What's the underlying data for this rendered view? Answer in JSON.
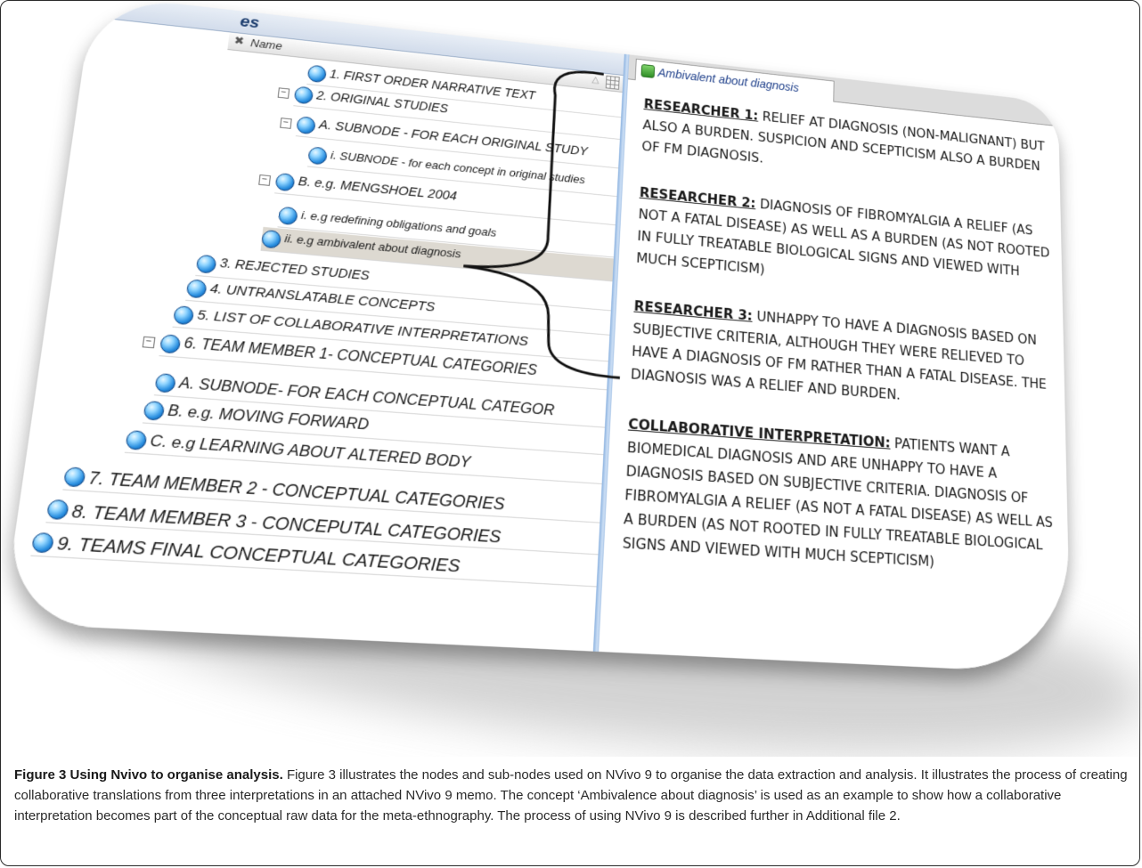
{
  "left_pane": {
    "title": "es",
    "column_header": "Name",
    "tree": [
      {
        "label": "1. FIRST ORDER NARRATIVE TEXT"
      },
      {
        "label": "2. ORIGINAL STUDIES",
        "expander": "−"
      },
      {
        "label": "A. SUBNODE - FOR EACH ORIGINAL STUDY",
        "expander": "−"
      },
      {
        "label": "i. SUBNODE - for each concept in original studies"
      },
      {
        "label": "B. e.g. MENGSHOEL 2004",
        "expander": "−"
      },
      {
        "label": "i. e.g redefining obligations and goals"
      },
      {
        "label": "ii. e.g ambivalent about diagnosis",
        "selected": true
      },
      {
        "label": "3. REJECTED STUDIES"
      },
      {
        "label": "4. UNTRANSLATABLE CONCEPTS"
      },
      {
        "label": "5. LIST OF COLLABORATIVE INTERPRETATIONS"
      },
      {
        "label": "6. TEAM MEMBER 1- CONCEPTUAL CATEGORIES",
        "expander": "−"
      },
      {
        "label": "A. SUBNODE- FOR EACH CONCEPTUAL CATEGOR"
      },
      {
        "label": "B. e.g. MOVING FORWARD"
      },
      {
        "label": "C. e.g LEARNING ABOUT ALTERED BODY"
      },
      {
        "label": "7. TEAM MEMBER 2 - CONCEPTUAL CATEGORIES"
      },
      {
        "label": "8. TEAM MEMBER 3 - CONCEPUTAL CATEGORIES"
      },
      {
        "label": "9. TEAMS FINAL CONCEPTUAL CATEGORIES"
      }
    ]
  },
  "right_pane": {
    "tab_label": "Ambivalent about diagnosis",
    "memo": [
      {
        "heading": "RESEARCHER 1:",
        "text": "RELIEF AT DIAGNOSIS (NON-MALIGNANT) BUT ALSO A BURDEN. SUSPICION AND SCEPTICISM ALSO A BURDEN OF FM DIAGNOSIS."
      },
      {
        "heading": "RESEARCHER 2:",
        "text": "DIAGNOSIS OF FIBROMYALGIA A RELIEF (AS NOT A FATAL DISEASE) AS WELL AS A BURDEN (AS NOT ROOTED IN FULLY TREATABLE BIOLOGICAL SIGNS AND VIEWED WITH MUCH SCEPTICISM)"
      },
      {
        "heading": "RESEARCHER 3:",
        "text": "UNHAPPY TO HAVE A DIAGNOSIS BASED ON SUBJECTIVE CRITERIA, ALTHOUGH THEY WERE RELIEVED TO HAVE A DIAGNOSIS OF FM RATHER THAN A FATAL DISEASE. THE DIAGNOSIS WAS A RELIEF AND BURDEN."
      },
      {
        "heading": "COLLABORATIVE INTERPRETATION:",
        "text": "PATIENTS WANT A BIOMEDICAL DIAGNOSIS AND ARE UNHAPPY TO HAVE A DIAGNOSIS BASED ON SUBJECTIVE CRITERIA. DIAGNOSIS OF FIBROMYALGIA A RELIEF (AS NOT A FATAL DISEASE) AS WELL AS A BURDEN (AS NOT ROOTED IN FULLY TREATABLE BIOLOGICAL SIGNS AND VIEWED WITH MUCH SCEPTICISM)"
      }
    ]
  },
  "caption": {
    "title": "Figure 3 Using Nvivo to organise analysis.",
    "body": "Figure 3 illustrates the nodes and sub-nodes used on NVivo 9 to organise the data extraction and analysis. It illustrates the process of creating collaborative translations from three interpretations in an attached NVivo 9 memo. The concept ‘Ambivalence about diagnosis’ is used as an example to show how a collaborative interpretation becomes part of the conceptual raw data for the meta-ethnography. The process of using NVivo 9 is described further in Additional file 2."
  },
  "colors": {
    "node_icon": "#2a8fe0",
    "splitter": "#8db3e0",
    "tab_text": "#1e3f8a",
    "selection": "#ddd9d1"
  }
}
